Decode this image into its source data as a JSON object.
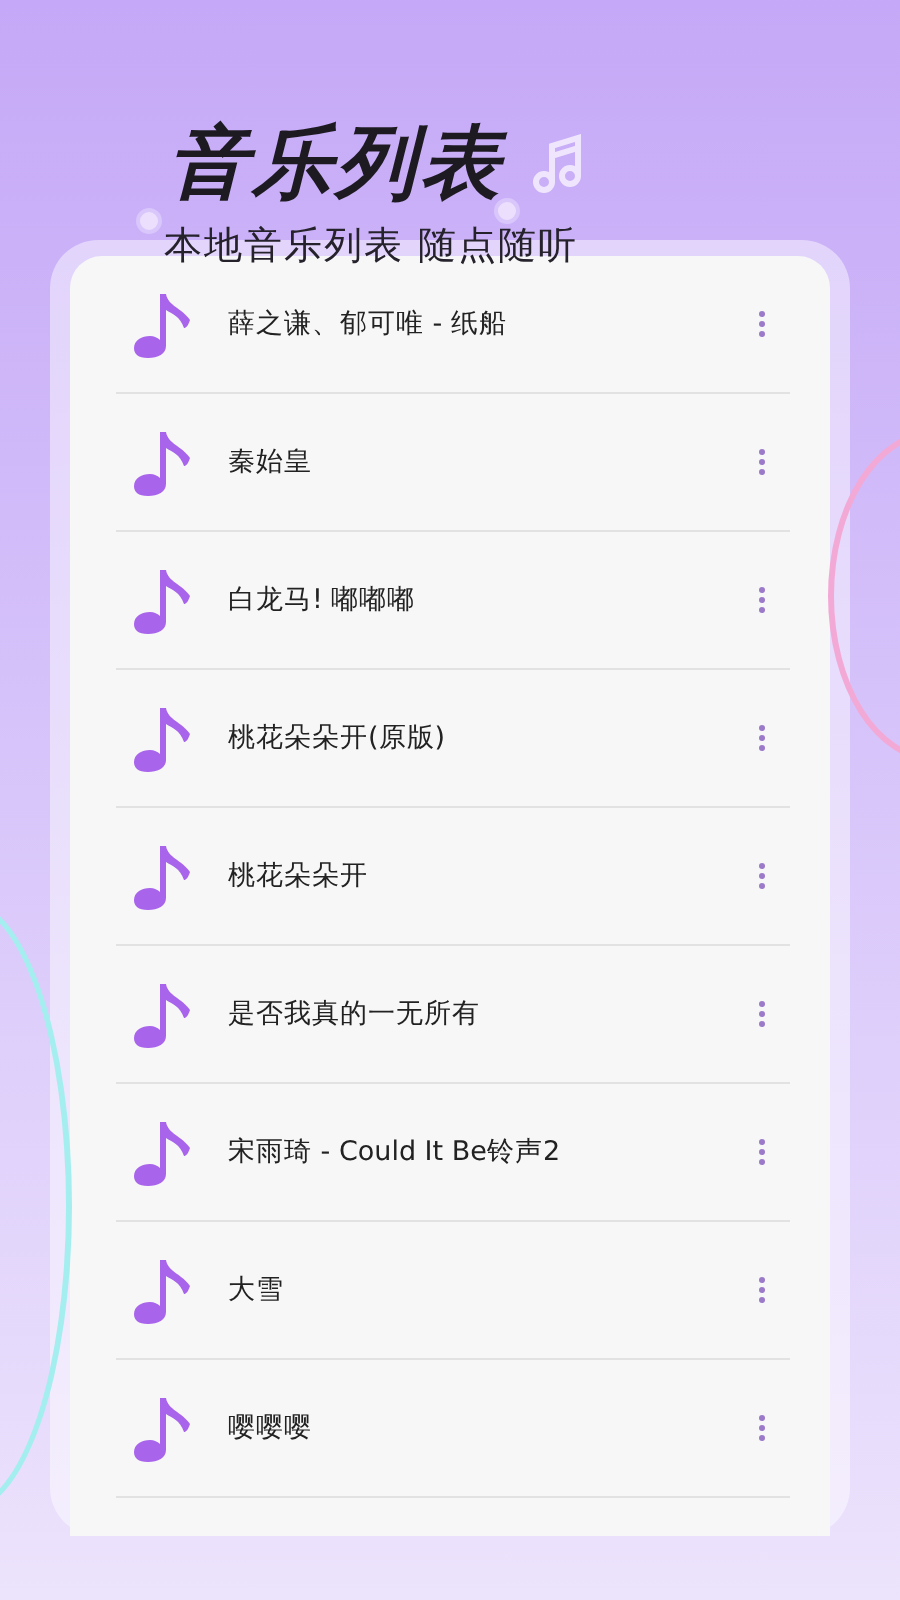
{
  "header": {
    "title": "音乐列表",
    "subtitle": "本地音乐列表 随点随听"
  },
  "songs": [
    {
      "title": "薛之谦、郁可唯 - 纸船"
    },
    {
      "title": "秦始皇"
    },
    {
      "title": "白龙马! 嘟嘟嘟"
    },
    {
      "title": "桃花朵朵开(原版)"
    },
    {
      "title": "桃花朵朵开"
    },
    {
      "title": "是否我真的一无所有"
    },
    {
      "title": "宋雨琦 - Could It Be铃声2"
    },
    {
      "title": "大雪"
    },
    {
      "title": "嘤嘤嘤"
    }
  ]
}
